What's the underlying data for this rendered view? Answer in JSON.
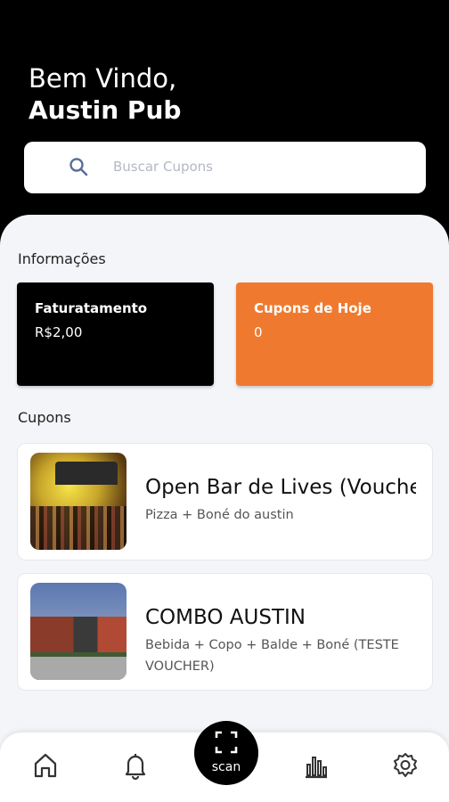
{
  "header": {
    "greeting": "Bem Vindo,",
    "user_name": "Austin Pub"
  },
  "search": {
    "placeholder": "Buscar Cupons",
    "icon": "search-icon"
  },
  "info": {
    "section_title": "Informações",
    "cards": [
      {
        "title": "Faturatamento",
        "value": "R$2,00",
        "color": "#000000"
      },
      {
        "title": "Cupons de Hoje",
        "value": "0",
        "color": "#EF7A2F"
      }
    ]
  },
  "coupons": {
    "section_title": "Cupons",
    "items": [
      {
        "title": "Open Bar de Lives (Voucher)",
        "description": "Pizza + Boné do austin"
      },
      {
        "title": "COMBO AUSTIN",
        "description": "Bebida + Copo + Balde + Boné (TESTE VOUCHER)"
      }
    ]
  },
  "nav": {
    "items": [
      {
        "icon": "home-icon"
      },
      {
        "icon": "bell-icon"
      },
      {
        "icon": "scan-icon",
        "label": "scan"
      },
      {
        "icon": "bar-chart-icon"
      },
      {
        "icon": "gear-icon"
      }
    ]
  }
}
